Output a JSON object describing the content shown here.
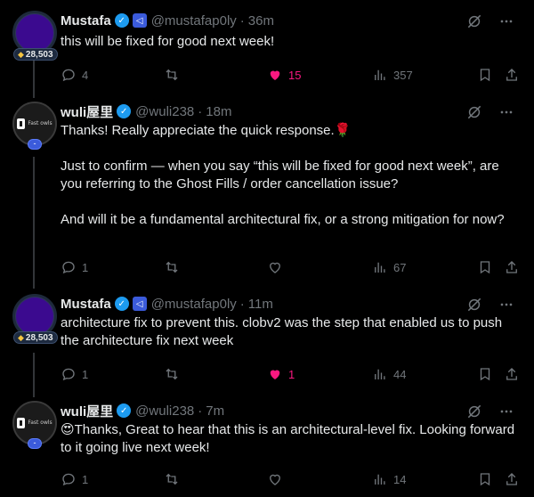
{
  "tweets": [
    {
      "name": "Mustafa",
      "handle": "@mustafap0ly",
      "time": "36m",
      "badge": "28,503",
      "text": "this will be fixed for good next week!",
      "replies": "4",
      "retweets": "",
      "likes": "15",
      "liked": true,
      "views": "357"
    },
    {
      "name": "wuli屋里",
      "handle": "@wuli238",
      "time": "18m",
      "avatar_text": "Fast owls",
      "text": "Thanks! Really appreciate the quick response.🌹\n\nJust to confirm — when you say “this will be fixed for good next week”, are you referring to the Ghost Fills / order cancellation issue?\n\nAnd will it be a fundamental architectural fix, or a strong mitigation for now?",
      "replies": "1",
      "retweets": "",
      "likes": "",
      "liked": false,
      "views": "67"
    },
    {
      "name": "Mustafa",
      "handle": "@mustafap0ly",
      "time": "11m",
      "badge": "28,503",
      "text": "architecture fix to prevent this. clobv2 was the step that enabled us to push the architecture fix next week",
      "replies": "1",
      "retweets": "",
      "likes": "1",
      "liked": true,
      "views": "44"
    },
    {
      "name": "wuli屋里",
      "handle": "@wuli238",
      "time": "7m",
      "avatar_text": "Fast owls",
      "text": "😍Thanks, Great to hear that this is an architectural-level fix. Looking forward to it going live next week!",
      "replies": "1",
      "retweets": "",
      "likes": "",
      "liked": false,
      "views": "14"
    }
  ],
  "colors": {
    "accent": "#1d9bf0",
    "like": "#f91880",
    "muted": "#71767b"
  }
}
